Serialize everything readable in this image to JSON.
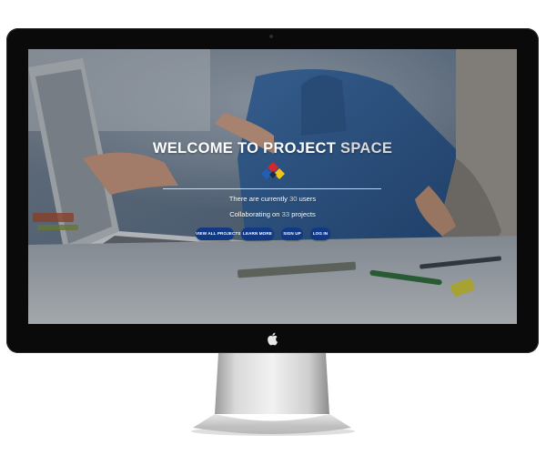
{
  "hero": {
    "title_main": "WELCOME TO PROJECT ",
    "title_accent": "SPACE",
    "users_prefix": "There are currently ",
    "users_count": "30",
    "users_suffix": " users",
    "projects_prefix": "Collaborating on ",
    "projects_count": "33",
    "projects_suffix": " projects"
  },
  "buttons": {
    "view_all": "VIEW ALL PROJECTS",
    "learn_more": "LEARN MORE",
    "sign_up": "SIGN UP",
    "log_in": "LOG IN"
  },
  "icons": {
    "brand_logo": "diamond-logo-icon",
    "apple": "apple-logo-icon",
    "camera": "camera-icon"
  },
  "colors": {
    "button_bg": "#123a84",
    "title_text": "#ffffff",
    "accent_text": "#d9d9d9",
    "logo_red": "#d6262b",
    "logo_blue": "#1f5fb8",
    "logo_yellow": "#f0c419",
    "logo_dark": "#1d2a4a"
  }
}
